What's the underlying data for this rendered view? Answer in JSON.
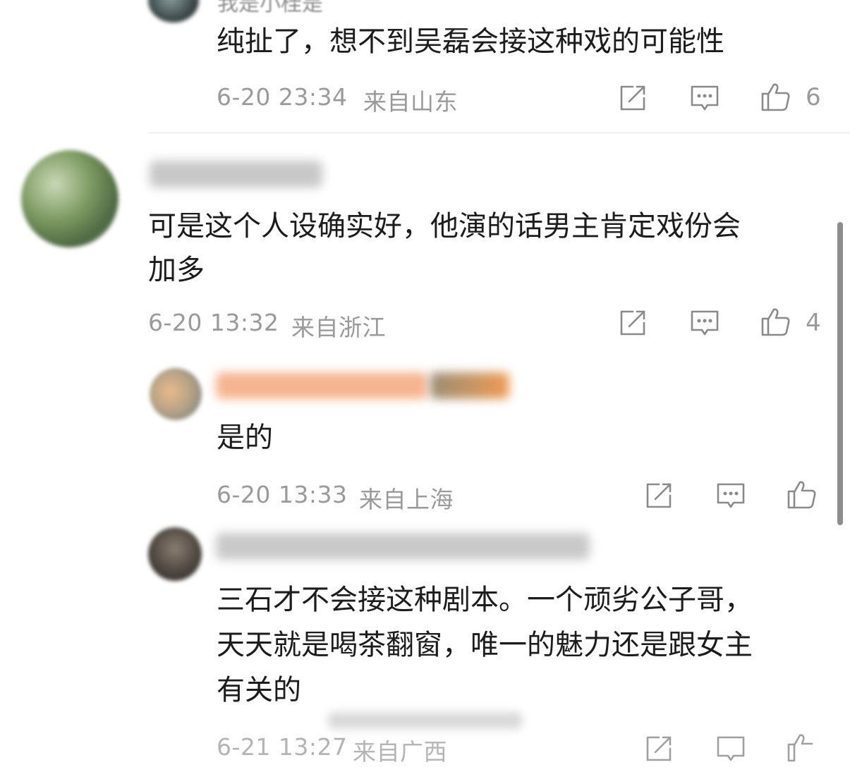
{
  "comments": [
    {
      "username_partial": "我是小桂是",
      "text": "纯扯了，想不到吴磊会接这种戏的可能性",
      "time": "6-20 23:34",
      "location": "来自山东",
      "likes": "6"
    },
    {
      "text_line1": "可是这个人设确实好，他演的话男主肯定戏份会",
      "text_line2": "加多",
      "time": "6-20 13:32",
      "location": "来自浙江",
      "likes": "4"
    },
    {
      "text": "是的",
      "time": "6-20 13:33",
      "location": "来自上海",
      "likes": ""
    },
    {
      "text_line1": "三石才不会接这种剧本。一个顽劣公子哥，",
      "text_line2": "天天就是喝茶翻窗，唯一的魅力还是跟女主",
      "text_line3": "有关的",
      "time_partial": "6-21 13:27",
      "location_partial": "来自广西"
    }
  ],
  "icons": {
    "repost": "repost-icon",
    "comment": "comment-icon",
    "like": "like-icon"
  },
  "colors": {
    "text": "#1c1c1c",
    "meta": "#9a9a9a",
    "name_blur_orange": "#f3a77a",
    "divider": "#e6e6e6"
  }
}
